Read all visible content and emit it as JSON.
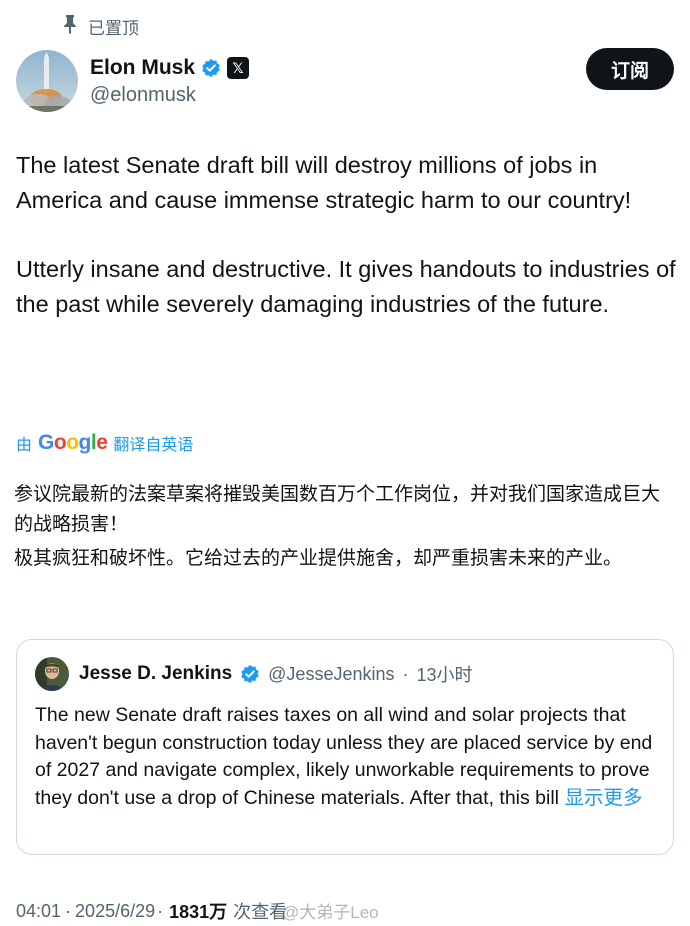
{
  "pinned": {
    "label": "已置顶",
    "icon": "pin-icon"
  },
  "author": {
    "display_name": "Elon Musk",
    "handle": "@elonmusk",
    "verified_icon": "verified-badge-icon",
    "affiliation_icon": "x-logo-icon",
    "affiliation_glyph": "𝕏"
  },
  "subscribe_label": "订阅",
  "tweet": {
    "paragraph_1": "The latest Senate draft bill will destroy millions of jobs in America and cause immense strategic harm to our country!",
    "paragraph_2": "Utterly insane and destructive. It gives handouts to industries of the past while severely damaging industries of the future."
  },
  "translation": {
    "by_label": "由",
    "google_letters": [
      "G",
      "o",
      "o",
      "g",
      "l",
      "e"
    ],
    "translate_label": "翻译自英语",
    "paragraph_1": "参议院最新的法案草案将摧毁美国数百万个工作岗位，并对我们国家造成巨大的战略损害！",
    "paragraph_2": "极其疯狂和破坏性。它给过去的产业提供施舍，却严重损害未来的产业。"
  },
  "quote": {
    "display_name": "Jesse D. Jenkins",
    "handle": "@JesseJenkins",
    "separator": "·",
    "time": "13小时",
    "text": "The new Senate draft raises taxes on all wind and solar projects that haven't begun construction today unless they are placed service by end of 2027 and navigate complex, likely unworkable requirements to prove they don't use a drop of Chinese materials. After that, this bill ",
    "show_more": "显示更多"
  },
  "footer": {
    "time": "04:01",
    "separator": "·",
    "date": "2025/6/29",
    "views": "1831万",
    "views_label": "次查看"
  },
  "watermark": "@大弟子Leo",
  "colors": {
    "accent": "#1d9bf0",
    "text": "#0f1419",
    "secondary": "#536471",
    "border": "#cfd9de"
  }
}
